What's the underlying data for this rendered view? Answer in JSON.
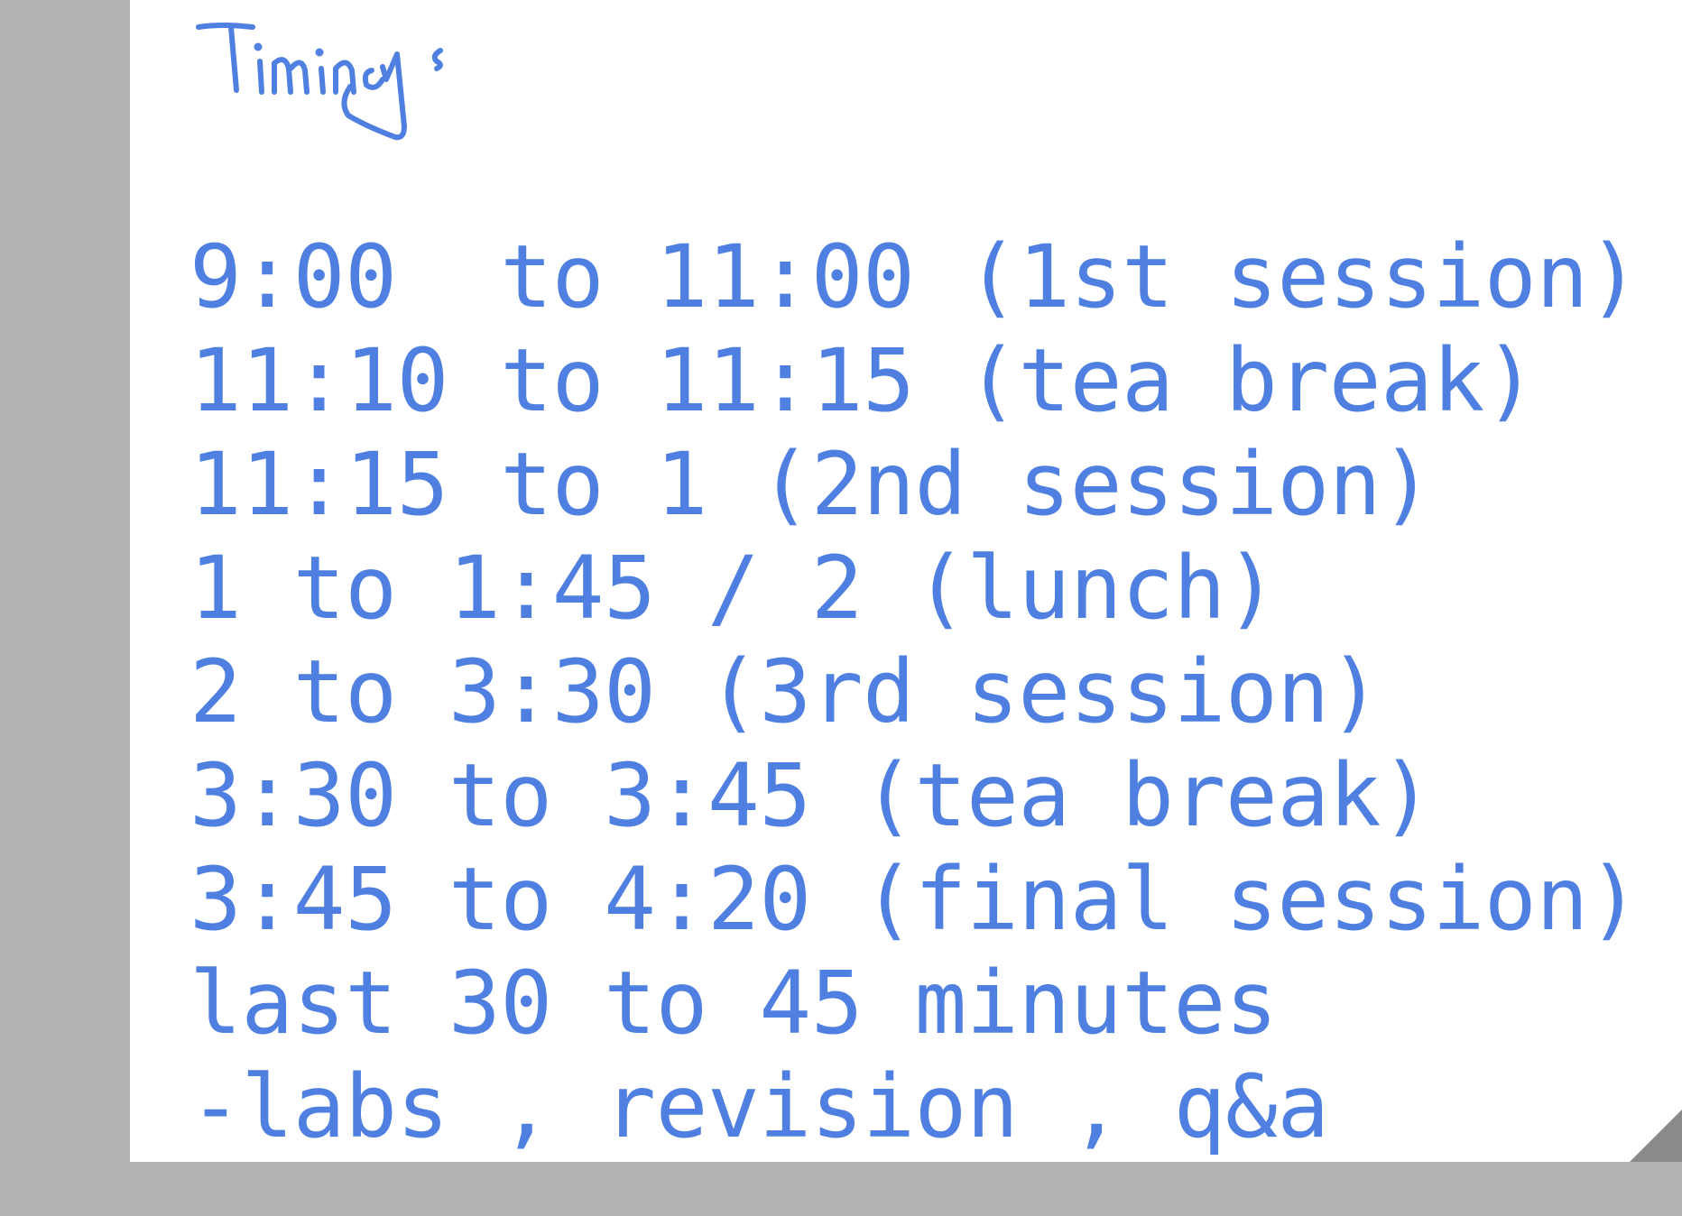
{
  "note": {
    "heading": "Timings",
    "ink_color": "#4f80e1",
    "paper_color": "#ffffff",
    "background_color": "#b3b3b3",
    "lines": [
      "9:00  to 11:00 (1st session)",
      "11:10 to 11:15 (tea break)",
      "11:15 to 1 (2nd session)",
      "1 to 1:45 / 2 (lunch)",
      "2 to 3:30 (3rd session)",
      "3:30 to 3:45 (tea break)",
      "3:45 to 4:20 (final session)",
      "last 30 to 45 minutes",
      "-labs , revision , q&a"
    ]
  }
}
